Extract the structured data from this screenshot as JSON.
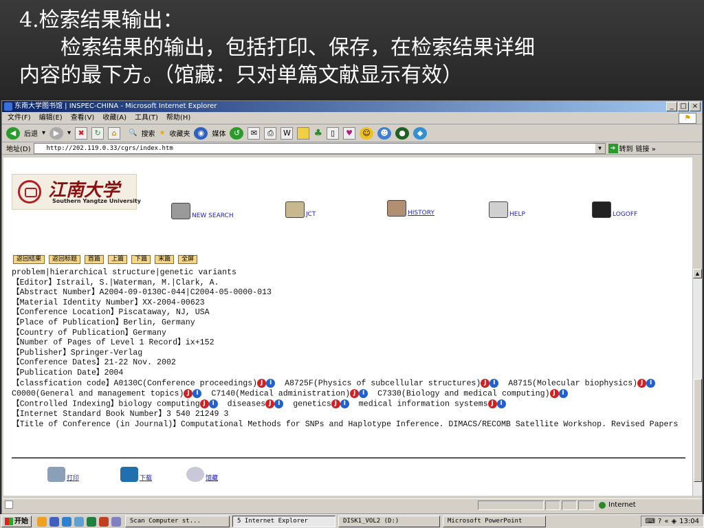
{
  "slide": {
    "line1": "4.检索结果输出：",
    "line2": "检索结果的输出，包括打印、保存，在检索结果详细",
    "line3": "内容的最下方。（馆藏：只对单篇文献显示有效）"
  },
  "browser": {
    "title": "东南大学图书馆 | INSPEC-CHINA - Microsoft Internet Explorer",
    "window_buttons": [
      "_",
      "□",
      "×"
    ],
    "menu": [
      "文件(F)",
      "编辑(E)",
      "查看(V)",
      "收藏(A)",
      "工具(T)",
      "帮助(H)"
    ],
    "toolbar": {
      "back": "后退",
      "search": "搜索",
      "favorites": "收藏夹",
      "media": "媒体"
    },
    "address_label": "地址(D)",
    "address": "http://202.119.0.33/cgrs/index.htm",
    "go_label": "转到",
    "links_label": "链接 »"
  },
  "page": {
    "logo": {
      "cn": "江南大学",
      "en": "Southern Yangtze University"
    },
    "nav": {
      "new_search": "NEW SEARCH",
      "jct": "JCT",
      "history": "HISTORY",
      "help": "HELP",
      "logoff": "LOGOFF"
    },
    "buttons": [
      "返回结果",
      "返回标题",
      "首篇",
      "上篇",
      "下篇",
      "末篇",
      "全屏"
    ],
    "record": {
      "line0": "problem|hierarchical structure|genetic variants",
      "fields": [
        "【Editor】Istrail, S.|Waterman, M.|Clark, A.",
        "【Abstract Number】A2004-09-0130C-044|C2004-05-0000-013",
        "【Material Identity Number】XX-2004-00623",
        "【Conference Location】Piscataway, NJ, USA",
        "【Place of Publication】Berlin, Germany",
        "【Country of Publication】Germany",
        "【Number of Pages of Level 1 Record】ix+152",
        "【Publisher】Springer-Verlag",
        "【Conference Dates】21-22 Nov. 2002",
        "【Publication Date】2004"
      ],
      "class_label": "【classfication code】",
      "classes": [
        "A0130C(Conference proceedings)",
        "A8725F(Physics of subcellular structures)",
        "A8715(Molecular biophysics)",
        "C0000(General and management topics)",
        "C7140(Medical administration)",
        "C7330(Biology and medical computing)"
      ],
      "ctrl_label": "【Controlled Indexing】",
      "indexing": [
        "biology computing",
        "diseases",
        "genetics",
        "medical information systems"
      ],
      "isbn": "【Internet Standard Book Number】3 540 21249 3",
      "title": "【Title of Conference (in Journal)】Computational Methods for SNPs and Haplotype Inference. DIMACS/RECOMB Satellite Workshop. Revised Papers"
    },
    "badges": {
      "red": "J",
      "blue": "I"
    },
    "output": {
      "print": "打印",
      "download": "下载",
      "holdings": "馆藏"
    }
  },
  "status": {
    "zone": "Internet"
  },
  "taskbar": {
    "start": "开始",
    "tasks": [
      "Scan Computer  st...",
      "5 Internet Explorer",
      "DISK1_VOL2 (D:)",
      "Microsoft PowerPoint"
    ],
    "clock": "13:04"
  }
}
